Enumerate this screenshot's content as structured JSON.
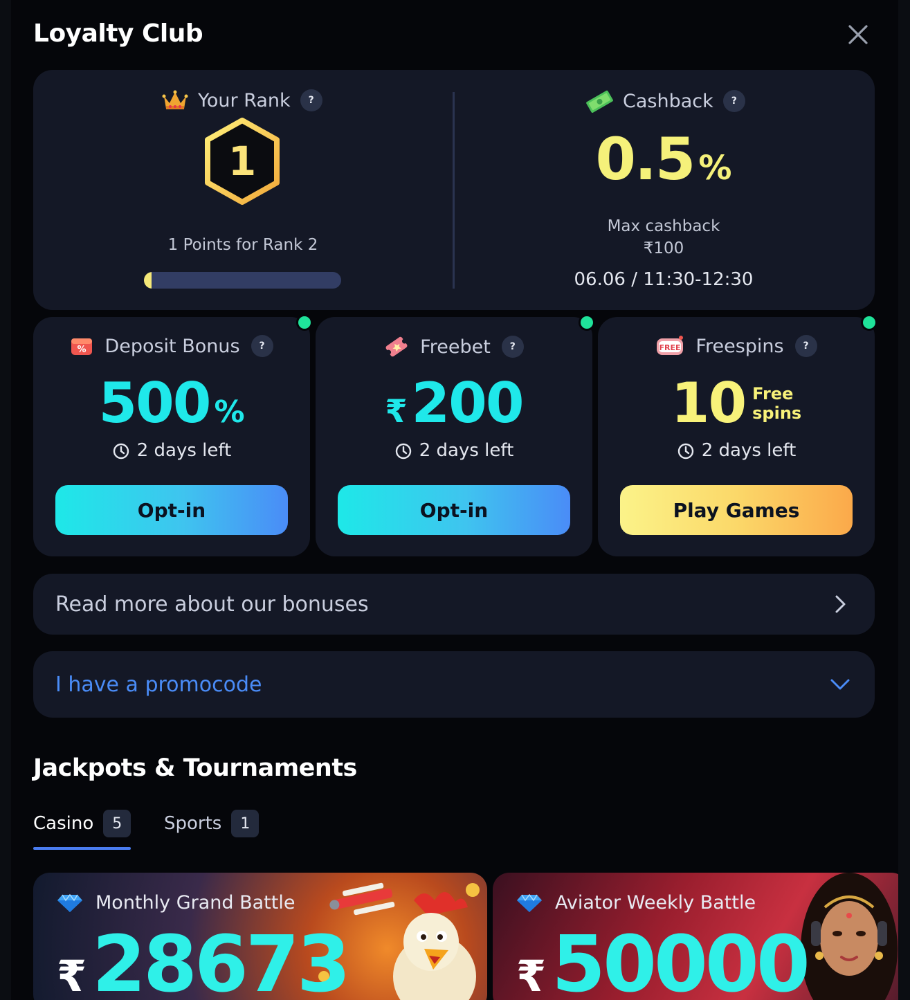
{
  "header": {
    "title": "Loyalty Club"
  },
  "rank": {
    "label": "Your Rank",
    "help": "?",
    "value": "1",
    "points_text": "1 Points for Rank 2",
    "progress": 0.04
  },
  "cashback": {
    "label": "Cashback",
    "help": "?",
    "value": "0.5",
    "unit": "%",
    "max_label": "Max cashback",
    "max_value": "₹100",
    "time": "06.06 / 11:30-12:30"
  },
  "bonuses": [
    {
      "title": "Deposit Bonus",
      "help": "?",
      "value": "500",
      "suffix": "%",
      "days": "2 days left",
      "cta": "Opt-in"
    },
    {
      "title": "Freebet",
      "help": "?",
      "currency": "₹",
      "value": "200",
      "days": "2 days left",
      "cta": "Opt-in"
    },
    {
      "title": "Freespins",
      "help": "?",
      "value": "10",
      "suffix_line1": "Free",
      "suffix_line2": "spins",
      "days": "2 days left",
      "cta": "Play Games"
    }
  ],
  "links": {
    "read_more": "Read more about our bonuses",
    "promocode": "I have a promocode"
  },
  "jackpots": {
    "title": "Jackpots & Tournaments",
    "tabs": [
      {
        "label": "Casino",
        "count": "5"
      },
      {
        "label": "Sports",
        "count": "1"
      }
    ],
    "cards": [
      {
        "name": "Monthly Grand Battle",
        "currency": "₹",
        "amount": "28673"
      },
      {
        "name": "Aviator Weekly Battle",
        "currency": "₹",
        "amount": "50000"
      }
    ]
  },
  "colors": {
    "accent_teal": "#1fe8ea",
    "accent_yellow": "#f5f17a",
    "status_green": "#1fe39a",
    "link_blue": "#4a8cf7"
  }
}
